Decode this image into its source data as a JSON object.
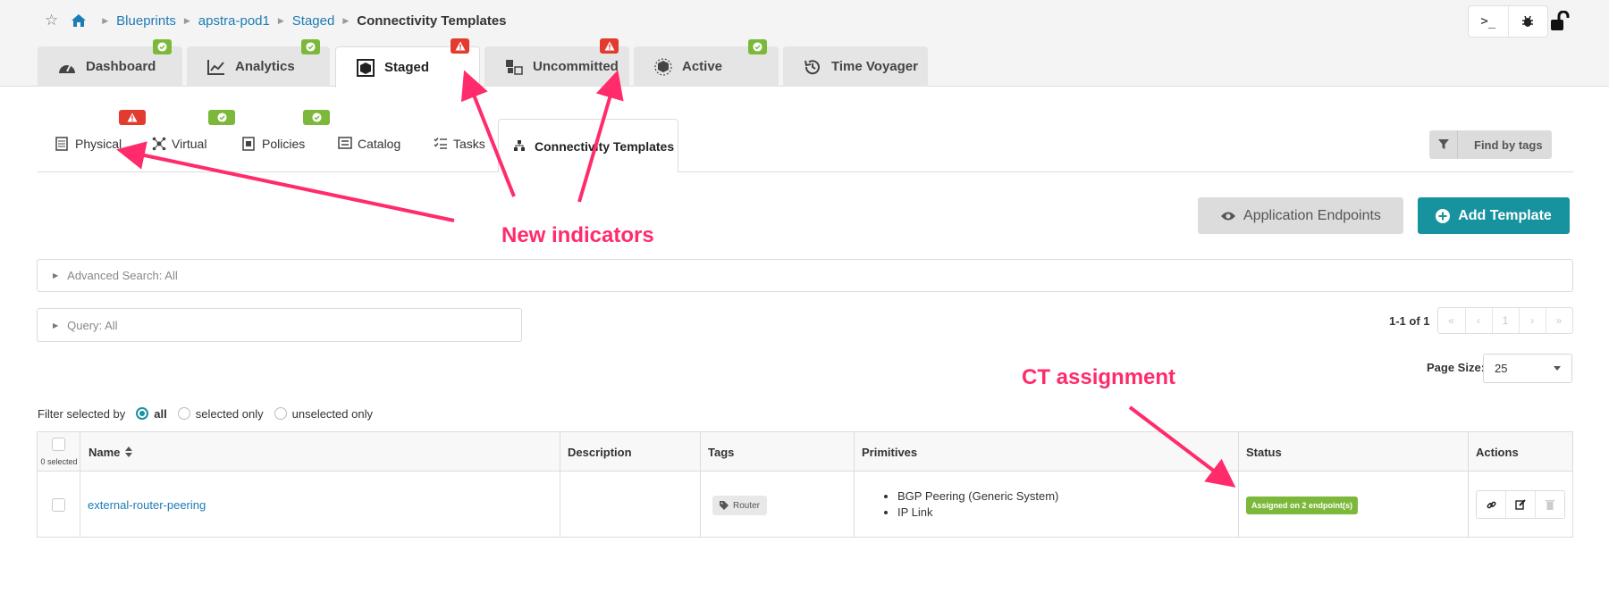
{
  "breadcrumb": {
    "items": [
      "Blueprints",
      "apstra-pod1",
      "Staged"
    ],
    "current": "Connectivity Templates"
  },
  "toolbar": {
    "cli_label": ">_"
  },
  "main_tabs": [
    {
      "label": "Dashboard",
      "badge": "ok"
    },
    {
      "label": "Analytics",
      "badge": "ok"
    },
    {
      "label": "Staged",
      "badge": "warn"
    },
    {
      "label": "Uncommitted",
      "badge": "warn"
    },
    {
      "label": "Active",
      "badge": "ok"
    },
    {
      "label": "Time Voyager",
      "badge": null
    }
  ],
  "sub_tabs": [
    {
      "label": "Physical",
      "badge": "warn"
    },
    {
      "label": "Virtual",
      "badge": "ok"
    },
    {
      "label": "Policies",
      "badge": "ok"
    },
    {
      "label": "Catalog",
      "badge": null
    },
    {
      "label": "Tasks",
      "badge": null
    },
    {
      "label": "Connectivity Templates",
      "badge": null
    }
  ],
  "find_by_tags": "Find by tags",
  "buttons": {
    "app_endpoints": "Application Endpoints",
    "add_template": "Add Template"
  },
  "advanced_search": "Advanced Search: All",
  "query": "Query: All",
  "pager": {
    "info": "1-1 of 1",
    "first": "«",
    "prev": "‹",
    "page": "1",
    "next": "›",
    "last": "»"
  },
  "page_size": {
    "label": "Page Size:",
    "value": "25"
  },
  "filter": {
    "label": "Filter selected by",
    "options": [
      "all",
      "selected only",
      "unselected only"
    ],
    "selected": "all"
  },
  "table": {
    "selected_count": "0 selected",
    "columns": [
      "Name",
      "Description",
      "Tags",
      "Primitives",
      "Status",
      "Actions"
    ],
    "rows": [
      {
        "name": "external-router-peering",
        "description": "",
        "tags": [
          "Router"
        ],
        "primitives": [
          "BGP Peering (Generic System)",
          "IP Link"
        ],
        "status": "Assigned on 2 endpoint(s)"
      }
    ]
  },
  "annotations": {
    "new_indicators": "New indicators",
    "ct_assignment": "CT assignment"
  },
  "colors": {
    "accent": "#17929f",
    "ok": "#7cb93a",
    "warn": "#e23b2f",
    "link": "#1b7cb6",
    "annotation": "#ff2b6b"
  }
}
